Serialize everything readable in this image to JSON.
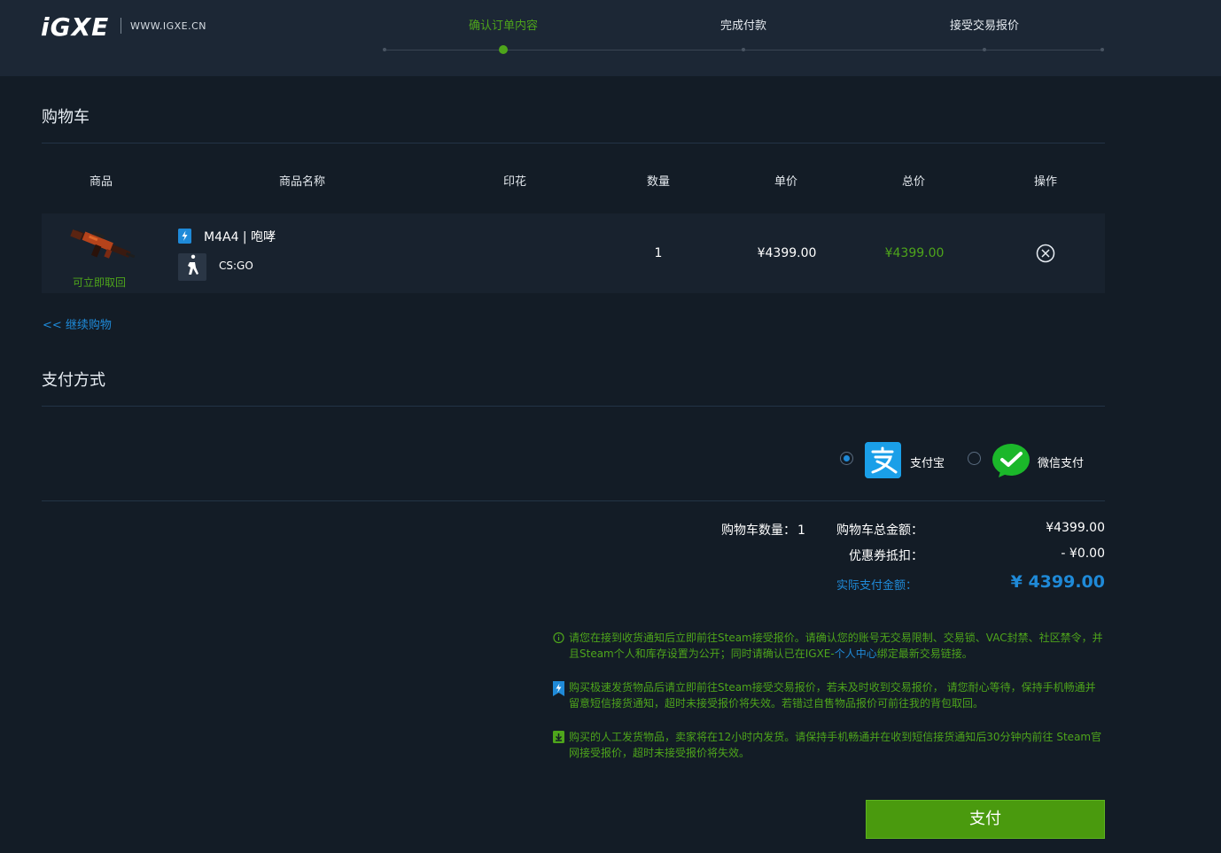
{
  "brand": {
    "logo": "iGXE",
    "domain": "WWW.IGXE.CN"
  },
  "steps": [
    {
      "label": "确认订单内容",
      "active": true
    },
    {
      "label": "完成付款",
      "active": false
    },
    {
      "label": "接受交易报价",
      "active": false
    }
  ],
  "cart": {
    "title": "购物车",
    "columns": [
      "商品",
      "商品名称",
      "印花",
      "数量",
      "单价",
      "总价",
      "操作"
    ],
    "item": {
      "name": "M4A4 | 咆哮",
      "game": "CS:GO",
      "status": "可立即取回",
      "sticker": "",
      "quantity": "1",
      "unit_price": "¥4399.00",
      "total_price": "¥4399.00"
    },
    "continue_link": "<< 继续购物"
  },
  "payment": {
    "title": "支付方式",
    "options": [
      {
        "label": "支付宝",
        "icon": "alipay-icon",
        "selected": true
      },
      {
        "label": "微信支付",
        "icon": "wechat-icon",
        "selected": false
      }
    ]
  },
  "summary": {
    "count_label": "购物车数量：",
    "count_value": "1",
    "total_label": "购物车总金额：",
    "total_value": "¥4399.00",
    "coupon_label": "优惠券抵扣：",
    "coupon_value": "-  ¥0.00",
    "actual_label": "实际支付金额：",
    "actual_value": "¥ 4399.00"
  },
  "notices": {
    "n1_a": "请您在接到收货通知后立即前往Steam接受报价。请确认您的账号无交易限制、交易锁、VAC封禁、社区禁令，并且Steam个人和库存设置为公开；同时请确认已在IGXE-",
    "n1_link": "个人中心",
    "n1_b": "绑定最新交易链接。",
    "n2": "购买极速发货物品后请立即前往Steam接受交易报价，若未及时收到交易报价， 请您耐心等待，保持手机畅通并留意短信接货通知，超时未接受报价将失效。若错过自售物品报价可前往我的背包取回。",
    "n3": "购买的人工发货物品，卖家将在12小时内发货。请保持手机畅通并在收到短信接货通知后30分钟内前往 Steam官网接受报价，超时未接受报价将失效。"
  },
  "pay_button": "支付",
  "colors": {
    "accent_green": "#4ea51b",
    "accent_blue": "#1f8ad8",
    "background": "#131c26",
    "header": "#1c2735"
  }
}
